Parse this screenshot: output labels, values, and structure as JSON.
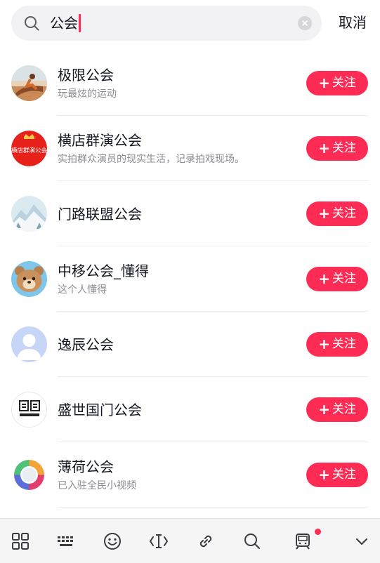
{
  "search": {
    "query": "公会",
    "cancel_label": "取消"
  },
  "results": [
    {
      "name": "极限公会",
      "desc": "玩最炫的运动",
      "follow_label": "关注",
      "avatar": "extreme-sports-photo"
    },
    {
      "name": "横店群演公会",
      "desc": "实拍群众演员的现实生活，记录拍戏现场。",
      "follow_label": "关注",
      "avatar": "red-seal-logo",
      "avatar_text": "横店群演公会"
    },
    {
      "name": "门路联盟公会",
      "desc": "",
      "follow_label": "关注",
      "avatar": "snow-mountain-photo"
    },
    {
      "name": "中移公会_懂得",
      "desc": "这个人懂得",
      "follow_label": "关注",
      "avatar": "cartoon-bear"
    },
    {
      "name": "逸辰公会",
      "desc": "",
      "follow_label": "关注",
      "avatar": "default-user"
    },
    {
      "name": "盛世国门公会",
      "desc": "",
      "follow_label": "关注",
      "avatar": "black-square-logo"
    },
    {
      "name": "薄荷公会",
      "desc": "已入驻全民小视频",
      "follow_label": "关注",
      "avatar": "rainbow-ring-logo"
    }
  ],
  "keyboard_toolbar": {
    "icons": [
      "grid-icon",
      "keyboard-icon",
      "emoji-icon",
      "text-cursor-icon",
      "link-icon",
      "search-icon",
      "train-icon",
      "chevron-down-icon"
    ],
    "badge_on": "train-icon"
  },
  "colors": {
    "accent": "#fe2c55",
    "text_primary": "#161823",
    "text_secondary": "#8a8b91"
  }
}
